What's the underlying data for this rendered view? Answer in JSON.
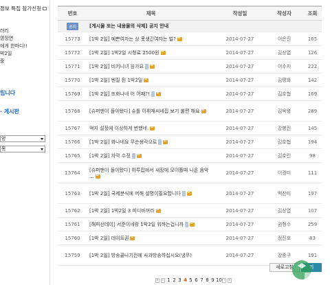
{
  "sidebar": {
    "top_link": "정보 특집 참가신청",
    "menu": [
      "러리",
      "명장면",
      "에게 한마디!!",
      "박2일",
      "종"
    ],
    "section1": "립니다",
    "section2": "· 게시판",
    "select1": "양",
    "select2": "목"
  },
  "board": {
    "headers": {
      "no": "번호",
      "title": "제목",
      "date": "작성일",
      "author": "작성자",
      "views": "조회"
    },
    "notice": {
      "badge": "공지",
      "title": "[게시물 또는 내용물의 삭제] 공지 안내"
    },
    "rows": [
      {
        "no": "15773",
        "title": "[1박 2일] 예쁜여자는 상 못생긴여자는 벌?",
        "b": true,
        "cam": false,
        "date": "2014-07-27",
        "author": "이은진",
        "views": "165",
        "tall": false
      },
      {
        "no": "15772",
        "title": "[1박 2일] 1박2일 시청료 2500원",
        "b": true,
        "cam": false,
        "date": "2014-07-27",
        "author": "김상엽",
        "views": "126",
        "tall": false
      },
      {
        "no": "15771",
        "title": "[1박 2일] 비키니녀 원가요",
        "b": true,
        "cam": true,
        "date": "2014-07-27",
        "author": "이수지",
        "views": "222",
        "tall": false
      },
      {
        "no": "15770",
        "title": "[1박 2일] 벤질 된 1박2일",
        "b": true,
        "cam": false,
        "date": "2014-07-27",
        "author": "김평화",
        "views": "142",
        "tall": false
      },
      {
        "no": "15769",
        "title": "[1박 2일] 또화나네 어 어째?!",
        "b": true,
        "cam": true,
        "date": "2014-07-27",
        "author": "김호협",
        "views": "169",
        "tall": false
      },
      {
        "no": "15768",
        "title": "[슈퍼맨이 돌아왔다] 슈틀 이휘재씨네집 보기 불편 해요",
        "b": true,
        "cam": false,
        "date": "2014-07-27",
        "author": "김옥영",
        "views": "289",
        "tall": true
      },
      {
        "no": "15767",
        "title": "억지 설정에 이상하게 변했네.",
        "b": true,
        "cam": false,
        "date": "2014-07-27",
        "author": "강병진",
        "views": "145",
        "tall": false
      },
      {
        "no": "15766",
        "title": "[1박 2일] 화나네요 무슨생각으로",
        "b": true,
        "cam": true,
        "date": "2014-07-27",
        "author": "김호협",
        "views": "194",
        "tall": false
      },
      {
        "no": "15765",
        "title": "[1박 2일] 자막 수정",
        "b": true,
        "cam": true,
        "date": "2014-07-27",
        "author": "김호린",
        "views": "98",
        "tall": false
      },
      {
        "no": "15764",
        "title": "[슈퍼맨이 돌아왔다] 하루집에서 새장에 모이플때 나온 음악 ...",
        "b": true,
        "cam": false,
        "date": "2014-07-27",
        "author": "이경미",
        "views": "111",
        "tall": true
      },
      {
        "no": "15763",
        "title": "[1박 2일] 국제분식에 머해 설명이필요합니다",
        "b": true,
        "cam": true,
        "date": "2014-07-27",
        "author": "백찬미",
        "views": "197",
        "tall": true
      },
      {
        "no": "15762",
        "title": "[1박 2일] 1박2일 3 피디바꺼라",
        "b": true,
        "cam": false,
        "date": "2014-07-27",
        "author": "김상엽",
        "views": "107",
        "tall": false
      },
      {
        "no": "15761",
        "title": "[해피선데이] 서준이네랑 1박2일 워하는겁니까",
        "b": true,
        "cam": true,
        "date": "2014-07-27",
        "author": "권형수",
        "views": "259",
        "tall": false
      },
      {
        "no": "15760",
        "title": "[1박 2일] 데이트권",
        "b": true,
        "cam": false,
        "date": "2014-07-27",
        "author": "정진호",
        "views": "83",
        "tall": false
      },
      {
        "no": "15759",
        "title": "[1박 2일] 방송끝나기전에 사과방송하십시요(냉무)",
        "b": false,
        "cam": false,
        "date": "2014-07-27",
        "author": "강중구",
        "views": "191",
        "tall": true
      }
    ],
    "reload_label": "새로고침",
    "write_label": "기"
  },
  "pager": {
    "pages": [
      "1",
      "2",
      "3",
      "4",
      "5",
      "6",
      "7",
      "8",
      "9",
      "10"
    ],
    "current": "4"
  }
}
